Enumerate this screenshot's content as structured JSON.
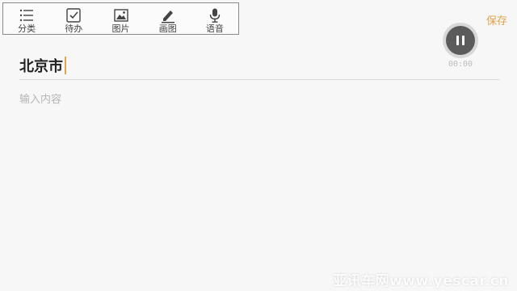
{
  "toolbar": {
    "items": [
      {
        "label": "分类",
        "icon": "list-icon"
      },
      {
        "label": "待办",
        "icon": "checkbox-icon"
      },
      {
        "label": "图片",
        "icon": "image-icon"
      },
      {
        "label": "画图",
        "icon": "pencil-icon"
      },
      {
        "label": "语音",
        "icon": "microphone-icon"
      }
    ]
  },
  "header": {
    "save_label": "保存"
  },
  "recorder": {
    "time": "00:00",
    "state": "recording"
  },
  "note": {
    "title": "北京市",
    "content_placeholder": "输入内容"
  },
  "watermark": "亚讯车网www.yescar.cn",
  "colors": {
    "accent": "#e0a24b",
    "text": "#222222",
    "placeholder": "#b5b5b5",
    "background": "#f7f7f7"
  }
}
